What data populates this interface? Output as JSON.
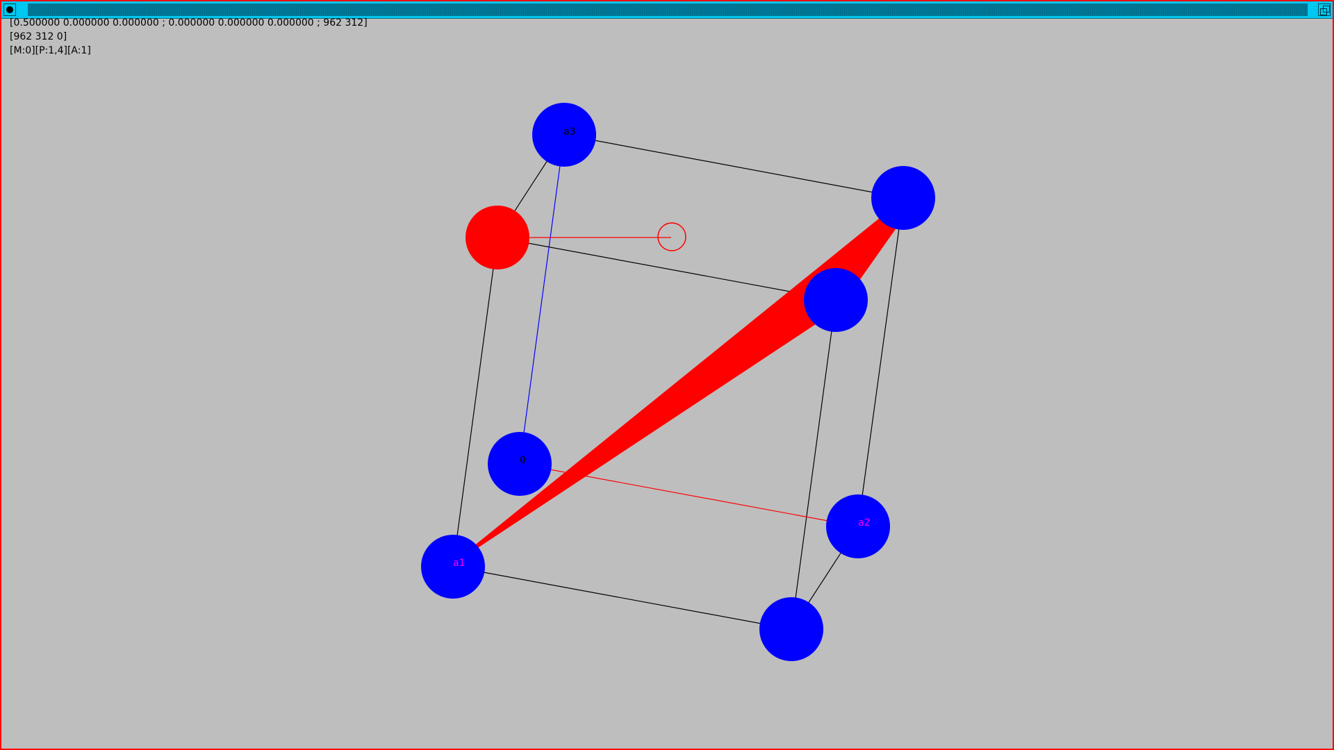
{
  "info": {
    "line1": "[0.500000 0.000000 0.000000 ; 0.000000 0.000000 0.000000 ; 962 312]",
    "line2": "[962 312 0]",
    "line3": "[M:0][P:1,4][A:1]"
  },
  "atoms": {
    "a3": {
      "label": "a3",
      "color": "#0000ff"
    },
    "origin": {
      "label": "0",
      "color": "#0000ff"
    },
    "a1": {
      "label": "a1",
      "color": "#0000ff"
    },
    "a2": {
      "label": "a2",
      "color": "#0000ff"
    },
    "selected": {
      "color": "#ff0000"
    }
  },
  "label_colors": {
    "a3": "#000000",
    "origin": "#000000",
    "a1": "#ff00ff",
    "a2": "#ff00ff"
  },
  "colors": {
    "background": "#bebebe",
    "frame": "#ff0000",
    "titlebar": "#00c8f0",
    "edge": "#000000",
    "axis_a3": "#0000ff",
    "bond": "#ff0000"
  }
}
